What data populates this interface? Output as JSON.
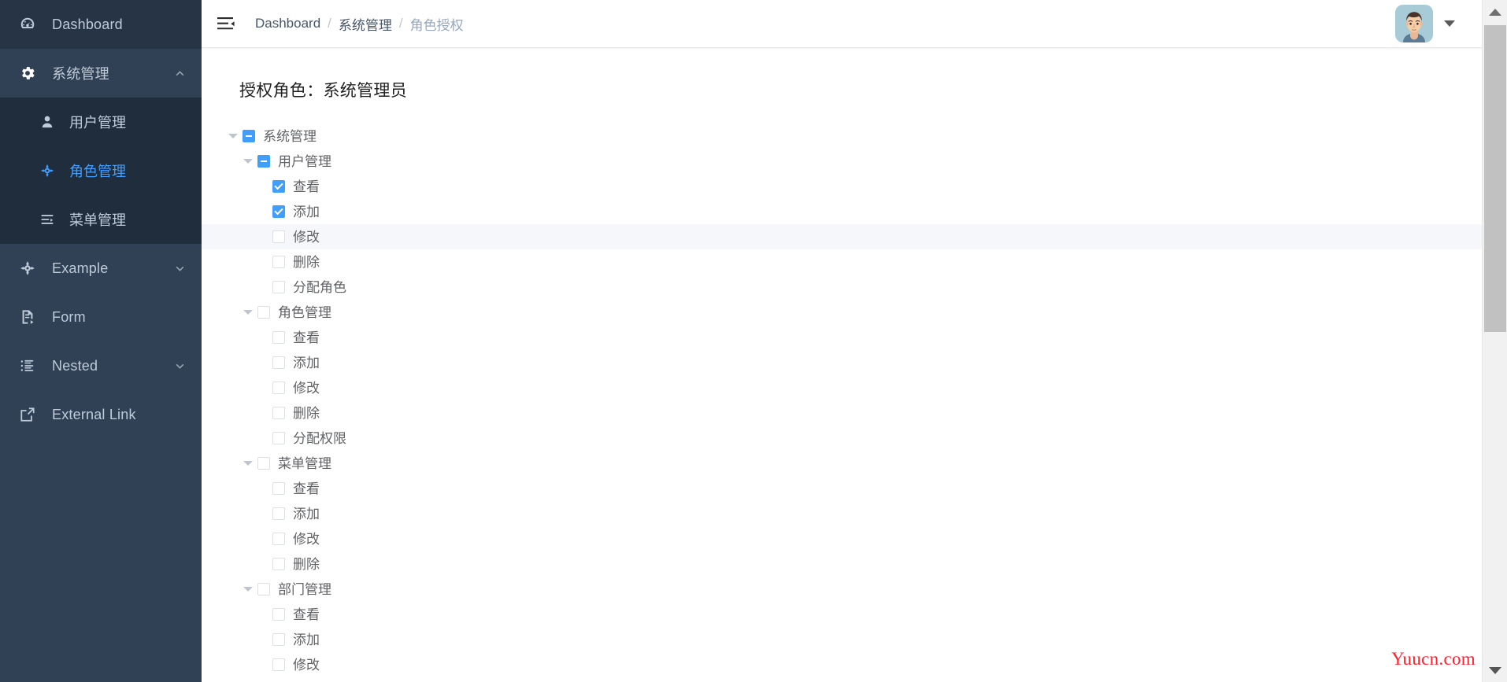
{
  "sidebar": {
    "items": [
      {
        "label": "Dashboard",
        "icon": "dashboard-icon",
        "type": "item",
        "expandable": false
      },
      {
        "label": "系统管理",
        "icon": "gear-icon",
        "type": "group",
        "expandable": true,
        "expanded": true,
        "children": [
          {
            "label": "用户管理",
            "icon": "user-icon",
            "active": false
          },
          {
            "label": "角色管理",
            "icon": "role-icon",
            "active": true
          },
          {
            "label": "菜单管理",
            "icon": "menu-list-icon",
            "active": false
          }
        ]
      },
      {
        "label": "Example",
        "icon": "component-icon",
        "type": "group",
        "expandable": true,
        "expanded": false
      },
      {
        "label": "Form",
        "icon": "form-icon",
        "type": "item",
        "expandable": false
      },
      {
        "label": "Nested",
        "icon": "nested-list-icon",
        "type": "group",
        "expandable": true,
        "expanded": false
      },
      {
        "label": "External Link",
        "icon": "external-link-icon",
        "type": "item",
        "expandable": false
      }
    ]
  },
  "navbar": {
    "hamburger_icon": "hamburger-icon",
    "breadcrumb": [
      {
        "label": "Dashboard",
        "current": false
      },
      {
        "label": "系统管理",
        "current": false
      },
      {
        "label": "角色授权",
        "current": true
      }
    ],
    "separator": "/",
    "avatar_icon": "user-avatar",
    "caret_icon": "caret-down-icon"
  },
  "content": {
    "page_title": "授权角色：系统管理员",
    "tree": [
      {
        "label": "系统管理",
        "level": 0,
        "arrow": true,
        "state": "indeterminate",
        "hovered": false
      },
      {
        "label": "用户管理",
        "level": 1,
        "arrow": true,
        "state": "indeterminate",
        "hovered": false
      },
      {
        "label": "查看",
        "level": 2,
        "arrow": false,
        "state": "checked",
        "hovered": false
      },
      {
        "label": "添加",
        "level": 2,
        "arrow": false,
        "state": "checked",
        "hovered": false
      },
      {
        "label": "修改",
        "level": 2,
        "arrow": false,
        "state": "unchecked",
        "hovered": true
      },
      {
        "label": "删除",
        "level": 2,
        "arrow": false,
        "state": "unchecked",
        "hovered": false
      },
      {
        "label": "分配角色",
        "level": 2,
        "arrow": false,
        "state": "unchecked",
        "hovered": false
      },
      {
        "label": "角色管理",
        "level": 1,
        "arrow": true,
        "state": "unchecked",
        "hovered": false
      },
      {
        "label": "查看",
        "level": 2,
        "arrow": false,
        "state": "unchecked",
        "hovered": false
      },
      {
        "label": "添加",
        "level": 2,
        "arrow": false,
        "state": "unchecked",
        "hovered": false
      },
      {
        "label": "修改",
        "level": 2,
        "arrow": false,
        "state": "unchecked",
        "hovered": false
      },
      {
        "label": "删除",
        "level": 2,
        "arrow": false,
        "state": "unchecked",
        "hovered": false
      },
      {
        "label": "分配权限",
        "level": 2,
        "arrow": false,
        "state": "unchecked",
        "hovered": false
      },
      {
        "label": "菜单管理",
        "level": 1,
        "arrow": true,
        "state": "unchecked",
        "hovered": false
      },
      {
        "label": "查看",
        "level": 2,
        "arrow": false,
        "state": "unchecked",
        "hovered": false
      },
      {
        "label": "添加",
        "level": 2,
        "arrow": false,
        "state": "unchecked",
        "hovered": false
      },
      {
        "label": "修改",
        "level": 2,
        "arrow": false,
        "state": "unchecked",
        "hovered": false
      },
      {
        "label": "删除",
        "level": 2,
        "arrow": false,
        "state": "unchecked",
        "hovered": false
      },
      {
        "label": "部门管理",
        "level": 1,
        "arrow": true,
        "state": "unchecked",
        "hovered": false
      },
      {
        "label": "查看",
        "level": 2,
        "arrow": false,
        "state": "unchecked",
        "hovered": false
      },
      {
        "label": "添加",
        "level": 2,
        "arrow": false,
        "state": "unchecked",
        "hovered": false
      },
      {
        "label": "修改",
        "level": 2,
        "arrow": false,
        "state": "unchecked",
        "hovered": false
      }
    ]
  },
  "watermark": {
    "text": "Yuucn.com"
  },
  "scrollbar": {
    "up_icon": "scroll-up-arrow",
    "down_icon": "scroll-down-arrow"
  },
  "colors": {
    "sidebar_bg": "#304156",
    "submenu_bg": "#1f2d3d",
    "accent": "#409eff",
    "menu_text": "#bfcbd9",
    "tree_text": "#606266",
    "watermark": "#ff1f2e",
    "hover_row": "#f5f7fa"
  }
}
